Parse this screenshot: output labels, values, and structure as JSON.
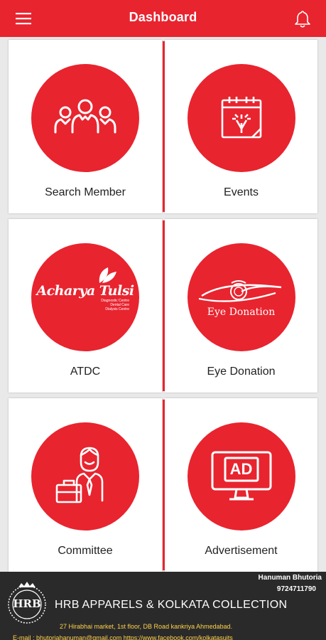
{
  "header": {
    "title": "Dashboard",
    "menu_icon": "hamburger-menu-icon",
    "notification_icon": "bell-icon"
  },
  "colors": {
    "accent": "#e8242f",
    "background": "#e9e9e9",
    "banner_bg": "#2a2a2a",
    "banner_highlight": "#ffd24a"
  },
  "dashboard": {
    "tiles": [
      {
        "label": "Search Member",
        "icon": "users-group-icon"
      },
      {
        "label": "Events",
        "icon": "calendar-fireworks-icon"
      },
      {
        "label": "ATDC",
        "icon": "acharya-tulsi-logo",
        "logo_text": "Acharya Tulsi",
        "logo_subtext": [
          "Diagnostic Centre",
          "Dental Care",
          "Dialysis Centre"
        ]
      },
      {
        "label": "Eye Donation",
        "icon": "eye-donation-logo",
        "logo_text": "Eye Donation"
      },
      {
        "label": "Committee",
        "icon": "businessman-briefcase-icon"
      },
      {
        "label": "Advertisement",
        "icon": "ad-monitor-icon",
        "icon_text": "AD"
      }
    ]
  },
  "banner": {
    "logo_text": "HRB",
    "person": "Hanuman Bhutoria",
    "phone": "9724711790",
    "company": "HRB APPARELS & KOLKATA COLLECTION",
    "address": "27 Hirabhai market, 1st floor, DB Road kankriya Ahmedabad.",
    "contact": "E-mail : bhutoriahanuman@gmail.com  https://www.facebook.com/kolkatasuits"
  }
}
